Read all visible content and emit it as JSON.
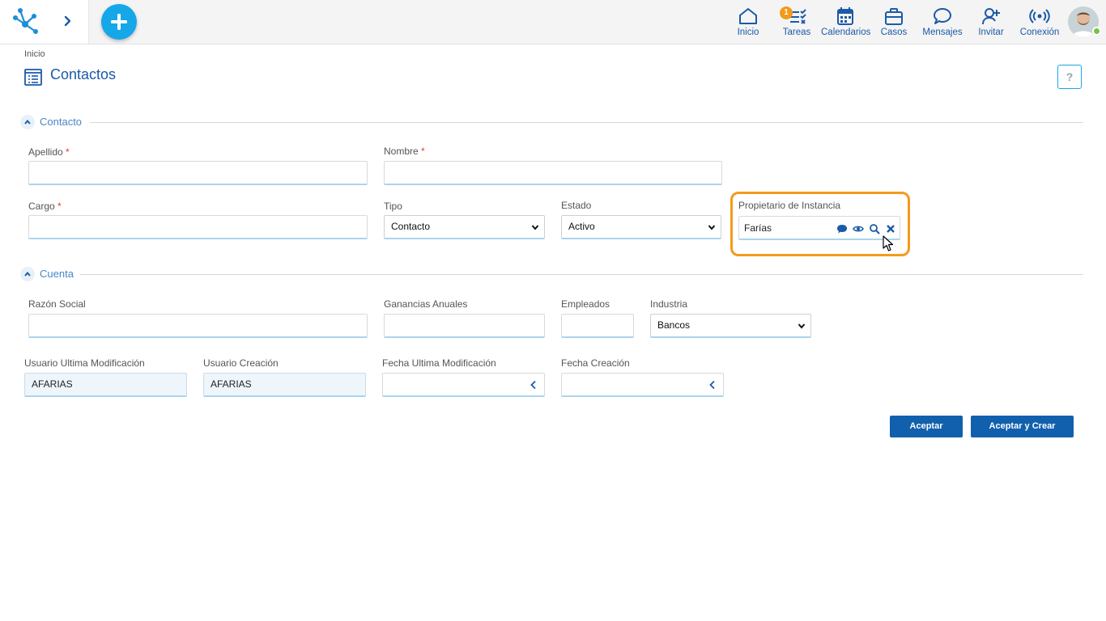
{
  "topbar": {
    "nav": [
      {
        "id": "inicio",
        "label": "Inicio",
        "icon": "home-icon"
      },
      {
        "id": "tareas",
        "label": "Tareas",
        "icon": "tasks-icon",
        "badge": "1"
      },
      {
        "id": "calendarios",
        "label": "Calendarios",
        "icon": "calendar-icon"
      },
      {
        "id": "casos",
        "label": "Casos",
        "icon": "briefcase-icon"
      },
      {
        "id": "mensajes",
        "label": "Mensajes",
        "icon": "chat-bubble-icon"
      },
      {
        "id": "invitar",
        "label": "Invitar",
        "icon": "invite-user-icon"
      },
      {
        "id": "conexion",
        "label": "Conexión",
        "icon": "connection-icon"
      }
    ],
    "accent": "#16a7e9",
    "nav_color": "#1b5aa8",
    "badge_color": "#f29a1a"
  },
  "header": {
    "breadcrumb": "Inicio",
    "title": "Contactos",
    "help_label": "?"
  },
  "sections": {
    "contacto": {
      "title": "Contacto",
      "fields": {
        "apellido": {
          "label": "Apellido",
          "required": "*",
          "value": ""
        },
        "nombre": {
          "label": "Nombre",
          "required": "*",
          "value": ""
        },
        "cargo": {
          "label": "Cargo",
          "required": "*",
          "value": ""
        },
        "tipo": {
          "label": "Tipo",
          "value": "Contacto"
        },
        "estado": {
          "label": "Estado",
          "value": "Activo"
        },
        "propietario": {
          "label": "Propietario de Instancia",
          "value": "Farías"
        }
      }
    },
    "cuenta": {
      "title": "Cuenta",
      "fields": {
        "razon_social": {
          "label": "Razón Social",
          "value": ""
        },
        "ganancias": {
          "label": "Ganancias Anuales",
          "value": ""
        },
        "empleados": {
          "label": "Empleados",
          "value": ""
        },
        "industria": {
          "label": "Industria",
          "value": "Bancos"
        },
        "usuario_ult_mod": {
          "label": "Usuario Ultima Modificación",
          "value": "AFARIAS"
        },
        "usuario_creacion": {
          "label": "Usuario Creación",
          "value": "AFARIAS"
        },
        "fecha_ult_mod": {
          "label": "Fecha Ultima Modificación",
          "value": ""
        },
        "fecha_creacion": {
          "label": "Fecha Creación",
          "value": ""
        }
      }
    }
  },
  "actions": {
    "accept": "Aceptar",
    "accept_create": "Aceptar y Crear",
    "button_color": "#1160ad"
  },
  "highlight_color": "#f39a1e"
}
